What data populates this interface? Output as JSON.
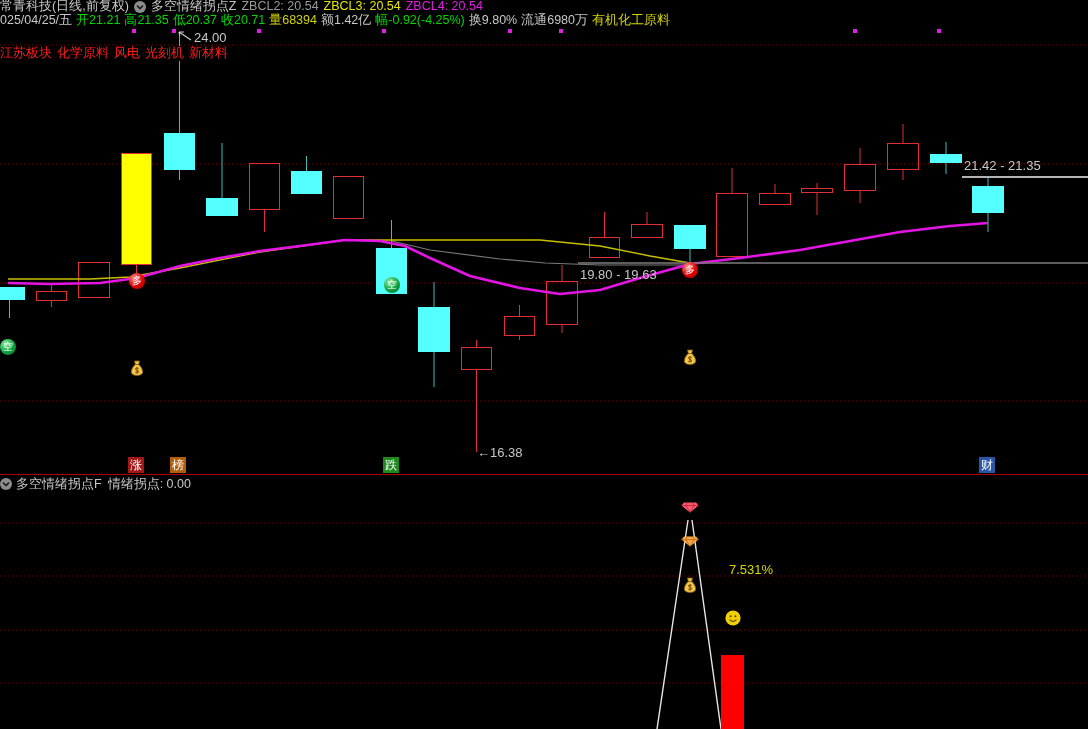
{
  "header": {
    "security": "常青科技(日线,前复权)",
    "indicator": "多空情绪拐点Z",
    "values": [
      {
        "text": "ZBCL2: 20.54",
        "color": "#9a9a9a"
      },
      {
        "text": "ZBCL3: 20.54",
        "color": "#e6e600"
      },
      {
        "text": "ZBCL4: 20.54",
        "color": "#e020e0"
      }
    ]
  },
  "quote": [
    {
      "text": "025/04/25/五",
      "color": "#c8c8c8"
    },
    {
      "text": "开21.21",
      "color": "#00d800"
    },
    {
      "text": "高21.35",
      "color": "#00d800"
    },
    {
      "text": "低20.37",
      "color": "#00d800"
    },
    {
      "text": "收20.71",
      "color": "#00d800"
    },
    {
      "text": "量68394",
      "color": "#d2d200"
    },
    {
      "text": "额1.42亿",
      "color": "#c8c8c8"
    },
    {
      "text": "幅-0.92(-4.25%)",
      "color": "#00d800"
    },
    {
      "text": "换9.80%",
      "color": "#c8c8c8"
    },
    {
      "text": "流通6980万",
      "color": "#c8c8c8"
    },
    {
      "text": "有机化工原料",
      "color": "#d2d200"
    }
  ],
  "sectors": [
    "江苏板块",
    "化学原料",
    "风电",
    "光刻机",
    "新材料"
  ],
  "price_chart": {
    "price_labels": [
      {
        "kind": "high",
        "text": "24.00"
      },
      {
        "kind": "range",
        "text": "21.42 - 21.35"
      },
      {
        "kind": "range",
        "text": "19.80 - 19.63"
      },
      {
        "kind": "low",
        "text": "←16.38"
      }
    ],
    "signals": [
      {
        "kind": "short",
        "label": "空"
      },
      {
        "kind": "long",
        "label": "多"
      },
      {
        "kind": "short",
        "label": "空"
      },
      {
        "kind": "long",
        "label": "多"
      }
    ],
    "tags": [
      {
        "label": "涨",
        "color": "#a01818"
      },
      {
        "label": "榜",
        "color": "#b0600c"
      },
      {
        "label": "跌",
        "color": "#1e8a1e"
      },
      {
        "label": "财",
        "color": "#2a56a8"
      }
    ]
  },
  "indicator_pane": {
    "title": "多空情绪拐点F",
    "reading": "情绪拐点: 0.00",
    "peak_percent": "7.531%"
  }
}
